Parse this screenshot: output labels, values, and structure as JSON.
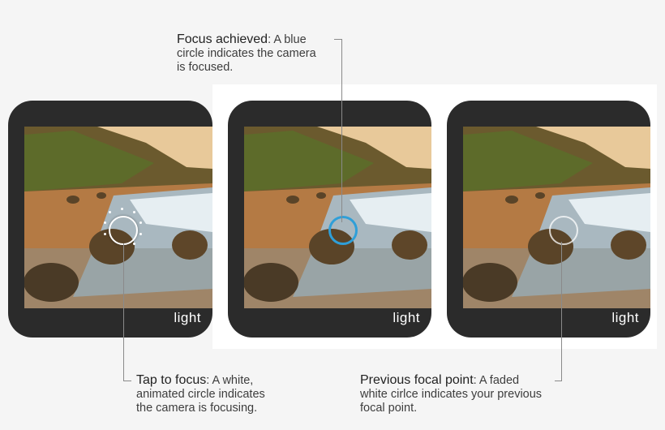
{
  "brand_logo": "light",
  "callouts": {
    "focus_achieved": {
      "title": "Focus achieved",
      "text_line1": ": A blue",
      "text_line2": "circle indicates the camera",
      "text_line3": "is focused."
    },
    "tap_to_focus": {
      "title": "Tap to focus",
      "text_line1": ": A white,",
      "text_line2": "animated circle indicates",
      "text_line3": "the camera is focusing."
    },
    "previous_focal_point": {
      "title": "Previous focal point",
      "text_line1": ": A faded",
      "text_line2": "white cirlce indicates your previous",
      "text_line3": "focal point."
    }
  },
  "colors": {
    "focus_blue": "#2f9fd8",
    "device_bezel": "#2b2b2b",
    "focus_white": "#ffffff"
  }
}
